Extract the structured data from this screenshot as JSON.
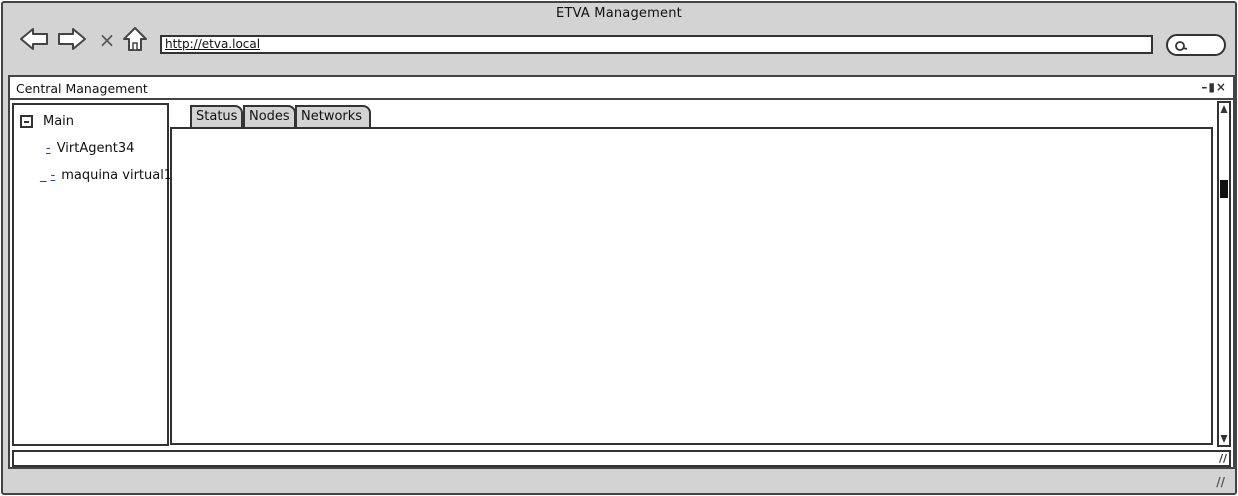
{
  "browser": {
    "title": "ETVA Management",
    "address": "http://etva.local",
    "stop_label": "×"
  },
  "app": {
    "title": "Central Management",
    "window_controls": "–▮×"
  },
  "tree": {
    "root": {
      "label": "Main",
      "expander": "−"
    },
    "items": [
      {
        "marker": "-",
        "label": "VirtAgent34"
      },
      {
        "marker": "-",
        "label": "maquina virtual1",
        "prefix": "_"
      }
    ]
  },
  "tabs": [
    {
      "label": "Status"
    },
    {
      "label": "Nodes"
    },
    {
      "label": "Networks"
    }
  ],
  "status_bar": {
    "grip": "//"
  },
  "browser_grip": "//",
  "colors": {
    "chrome": "#d3d3d3",
    "border": "#333333",
    "link": "#1b4fa8"
  }
}
